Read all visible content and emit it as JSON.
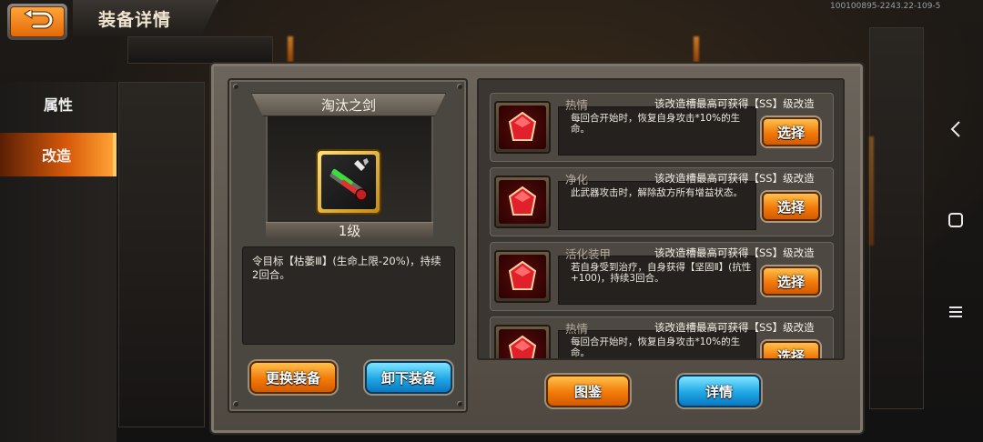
{
  "header": {
    "title": "装备详情",
    "version_text": "100100895-2243.22-109-5"
  },
  "nav": {
    "items": [
      {
        "label": "属性"
      },
      {
        "label": "改造"
      }
    ],
    "selected": "改造"
  },
  "equipment": {
    "name": "淘汰之剑",
    "level": "1级",
    "description": "令目标【枯萎Ⅲ】(生命上限-20%)，持续2回合。"
  },
  "left_buttons": {
    "replace": "更换装备",
    "unequip": "卸下装备"
  },
  "modifications": [
    {
      "name": "热情",
      "limit": "该改造槽最高可获得【SS】级改造",
      "desc": "每回合开始时，恢复自身攻击*10%的生命。",
      "button": "选择"
    },
    {
      "name": "净化",
      "limit": "该改造槽最高可获得【SS】级改造",
      "desc": "此武器攻击时，解除敌方所有增益状态。",
      "button": "选择"
    },
    {
      "name": "活化装甲",
      "limit": "该改造槽最高可获得【SS】级改造",
      "desc": "若自身受到治疗，自身获得【坚固Ⅱ】(抗性+100)，持续3回合。",
      "button": "选择"
    },
    {
      "name": "热情",
      "limit": "该改造槽最高可获得【SS】级改造",
      "desc": "每回合开始时，恢复自身攻击*10%的生命。",
      "button": "选择"
    }
  ],
  "right_buttons": {
    "atlas": "图鉴",
    "details": "详情"
  },
  "colors": {
    "accent_orange": "#f27a0a",
    "accent_blue": "#1fa7e6",
    "gem_red": "#e0202a"
  }
}
